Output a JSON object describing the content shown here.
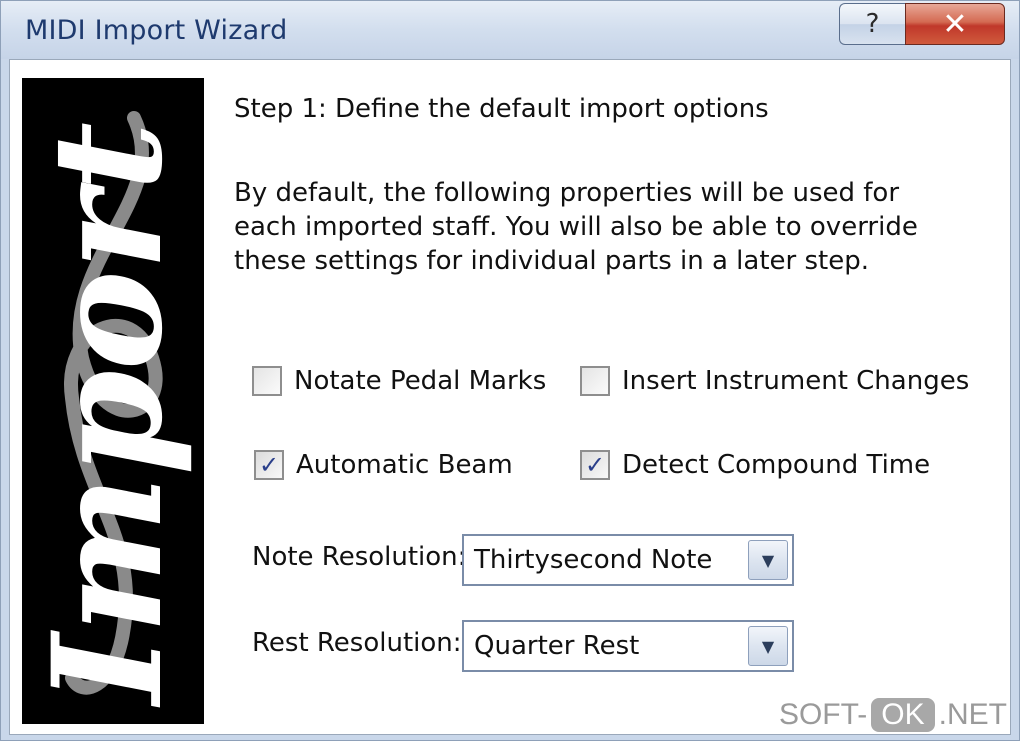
{
  "window": {
    "title": "MIDI Import Wizard",
    "help_glyph": "?",
    "close_glyph": "✕"
  },
  "side_image": {
    "text": "Import",
    "icon": "treble-clef-icon"
  },
  "step": {
    "title": "Step 1: Define the default import options",
    "description": "By default, the following properties will be used for each imported staff. You will also be able to override these settings for individual parts in a later step."
  },
  "options": {
    "notate_pedal_marks": {
      "label": "Notate Pedal Marks",
      "checked": false
    },
    "insert_instrument_changes": {
      "label": "Insert Instrument Changes",
      "checked": false
    },
    "automatic_beam": {
      "label": "Automatic Beam",
      "checked": true
    },
    "detect_compound_time": {
      "label": "Detect Compound Time",
      "checked": true
    }
  },
  "note_resolution": {
    "label": "Note Resolution:",
    "value": "Thirtysecond Note"
  },
  "rest_resolution": {
    "label": "Rest Resolution:",
    "value": "Quarter Rest"
  },
  "watermark": {
    "left": "SOFT-",
    "middle": "OK",
    "right": ".NET"
  },
  "colors": {
    "title_text": "#1e3a6e",
    "close_button": "#c0382a",
    "check_mark": "#2a3f8a"
  }
}
